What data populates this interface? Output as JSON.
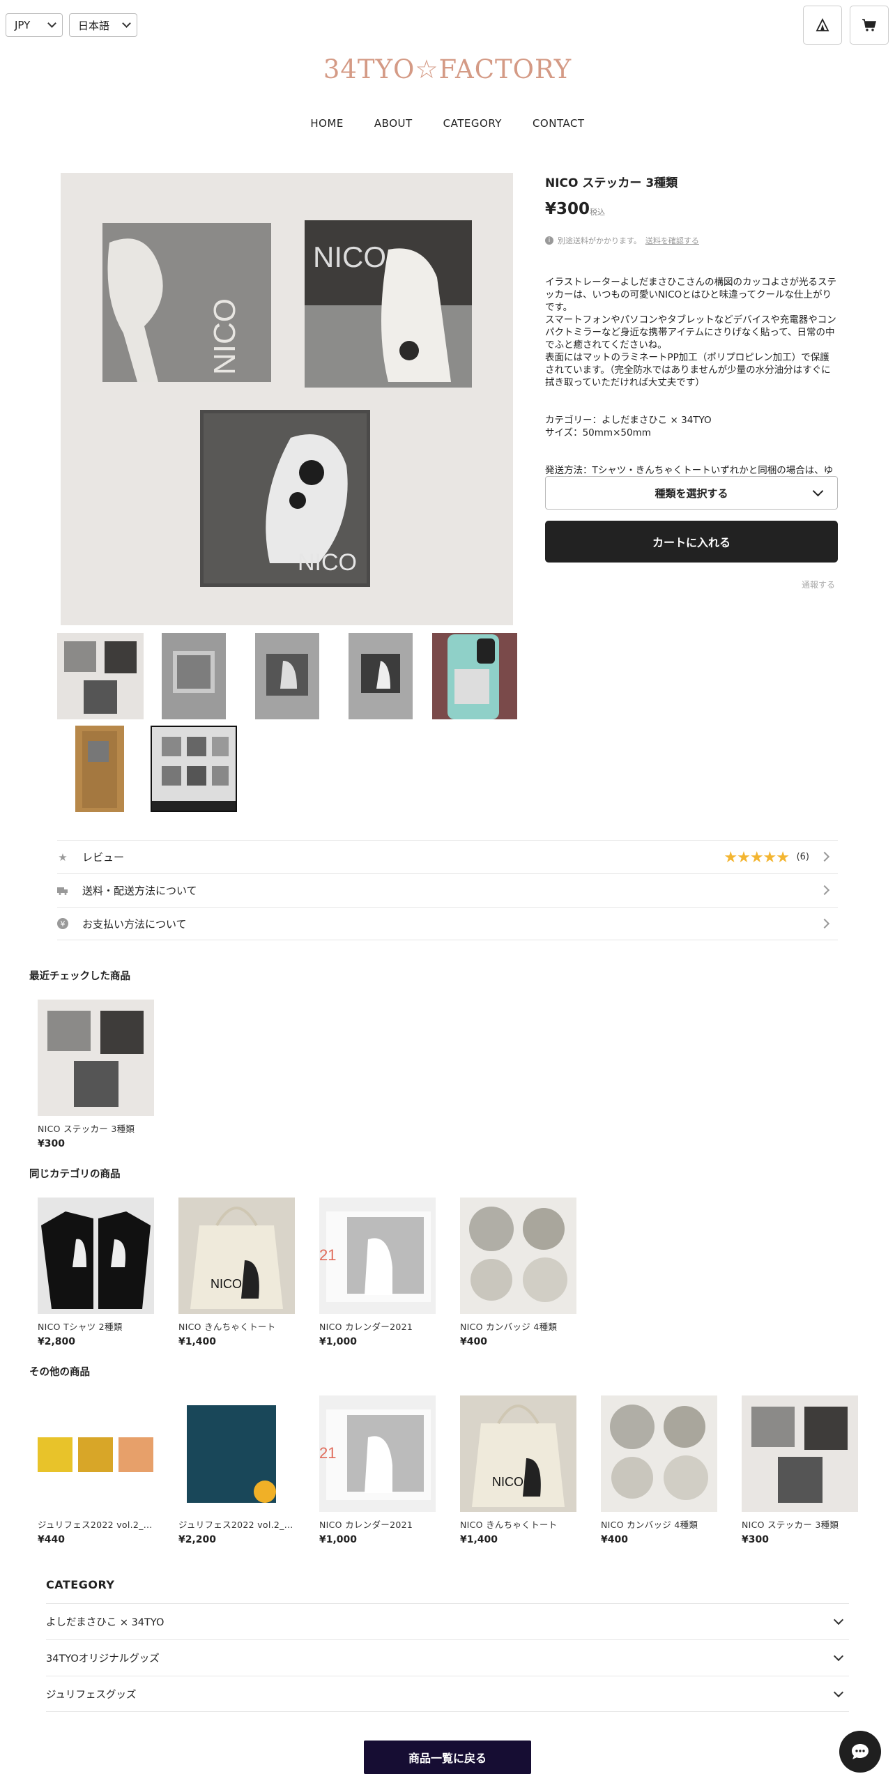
{
  "header": {
    "currency": "JPY",
    "language": "日本語",
    "logo": "34TYO☆FACTORY",
    "nav": [
      "HOME",
      "ABOUT",
      "CATEGORY",
      "CONTACT"
    ],
    "account_icon": "tent-icon",
    "cart_icon": "cart-icon"
  },
  "product": {
    "title": "NICO ステッカー 3種類",
    "price": "¥300",
    "tax_label": "税込",
    "shipping_note": "別途送料がかかります。",
    "shipping_link": "送料を確認する",
    "description": "イラストレーターよしだまさひこさんの構図のカッコよさが光るステッカーは、いつもの可愛いNICOとはひと味違ってクールな仕上がりです。\nスマートフォンやパソコンやタブレットなどデバイスや充電器やコンパクトミラーなど身近な携帯アイテムにさりげなく貼って、日常の中でふと癒されてくださいね。\n表面にはマットのラミネートPP加工（ポリプロピレン加工）で保護されています。（完全防水ではありませんが少量の水分油分はすぐに拭き取っていただければ大丈夫です）",
    "spec": "カテゴリー：よしだまさひこ × 34TYO\nサイズ：50mm×50mm",
    "shipping_method": "発送方法：Tシャツ・きんちゃくトートいずれかと同梱の場合は、ゆうパックをご選択ください。",
    "variant_select": "種類を選択する",
    "add_to_cart": "カートに入れる",
    "report": "通報する",
    "sticker_word": "NICO"
  },
  "info_rows": [
    {
      "label": "レビュー",
      "icon": "star-icon",
      "rating": 5,
      "count": "(6)"
    },
    {
      "label": "送料・配送方法について",
      "icon": "truck-icon"
    },
    {
      "label": "お支払い方法について",
      "icon": "yen-icon"
    }
  ],
  "recent": {
    "title": "最近チェックした商品",
    "items": [
      {
        "name": "NICO ステッカー 3種類",
        "price": "¥300"
      }
    ]
  },
  "same_category": {
    "title": "同じカテゴリの商品",
    "items": [
      {
        "name": "NICO Tシャツ 2種類",
        "price": "¥2,800"
      },
      {
        "name": "NICO きんちゃくトート",
        "price": "¥1,400"
      },
      {
        "name": "NICO カレンダー2021",
        "price": "¥1,000"
      },
      {
        "name": "NICO カンバッジ 4種類",
        "price": "¥400"
      }
    ]
  },
  "others": {
    "title": "その他の商品",
    "items": [
      {
        "name": "ジュリフェス2022 vol.2_...",
        "price": "¥440"
      },
      {
        "name": "ジュリフェス2022 vol.2_...",
        "price": "¥2,200"
      },
      {
        "name": "NICO カレンダー2021",
        "price": "¥1,000"
      },
      {
        "name": "NICO きんちゃくトート",
        "price": "¥1,400"
      },
      {
        "name": "NICO カンバッジ 4種類",
        "price": "¥400"
      },
      {
        "name": "NICO ステッカー 3種類",
        "price": "¥300"
      }
    ]
  },
  "category": {
    "title": "CATEGORY",
    "items": [
      "よしだまさひこ × 34TYO",
      "34TYOオリジナルグッズ",
      "ジュリフェスグッズ"
    ]
  },
  "back_button": "商品一覧に戻る",
  "colors": {
    "logo": "#d49a85",
    "star": "#f3b531",
    "cart_button": "#222222",
    "back_button": "#160d33"
  }
}
